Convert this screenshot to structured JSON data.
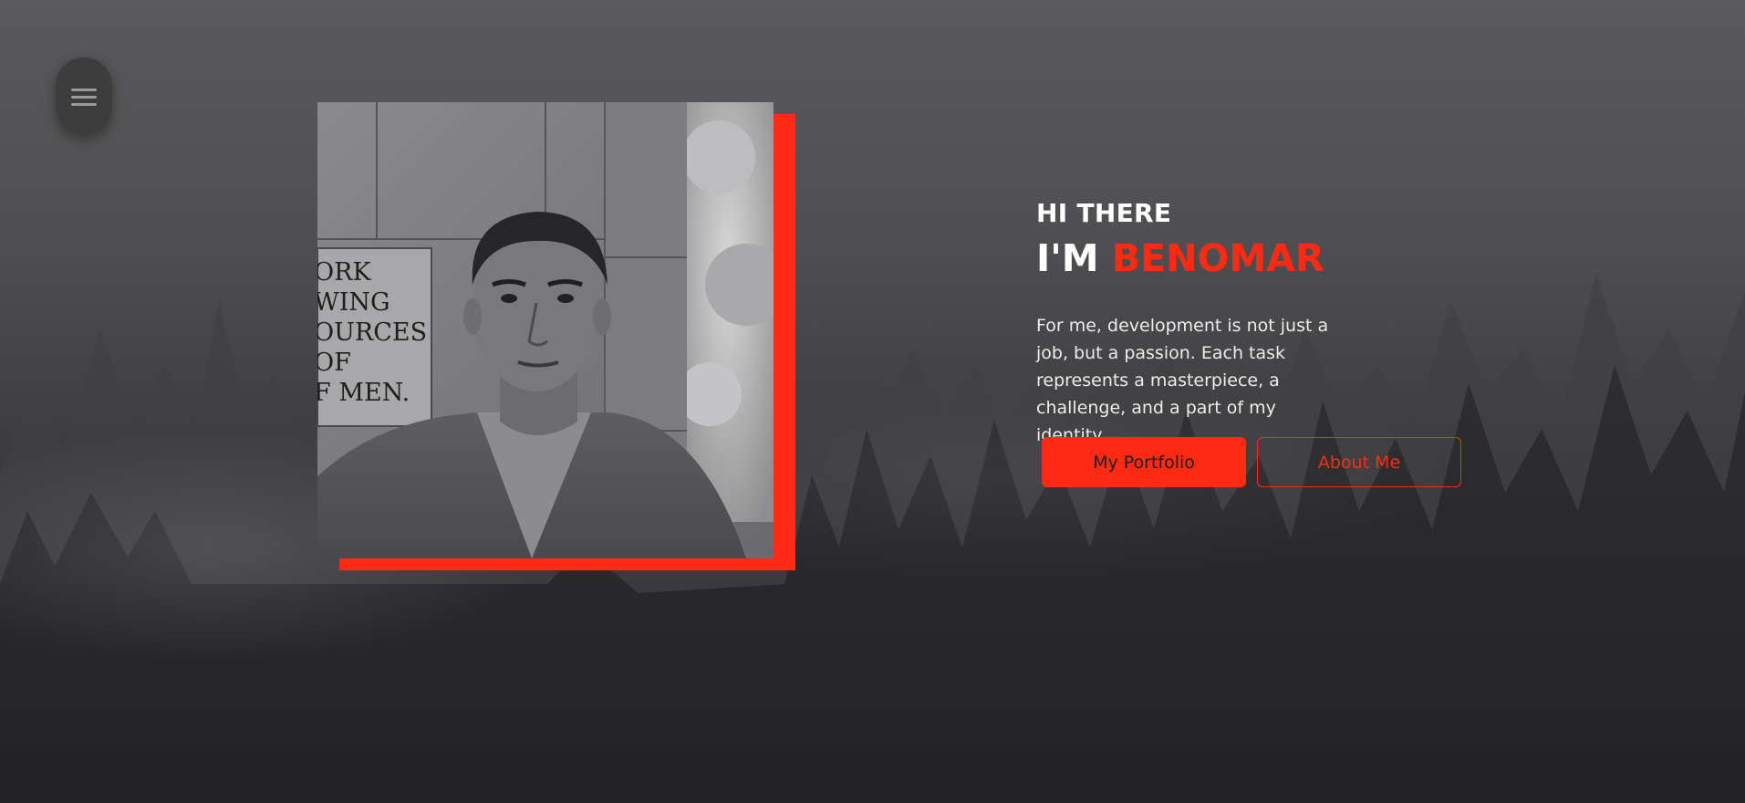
{
  "menu": {
    "icon": "hamburger-menu-icon"
  },
  "hero": {
    "greeting": "HI THERE",
    "name_prefix": "I'M ",
    "name": "BENOMAR",
    "description": "For me, development is not just a job, but a passion. Each task represents a masterpiece, a challenge, and a part of my identity.",
    "buttons": {
      "portfolio": "My Portfolio",
      "about": "About Me"
    }
  },
  "photo": {
    "plaque_lines": [
      "ORK",
      "WING",
      "OURCES",
      "OF",
      "F MEN."
    ]
  },
  "colors": {
    "accent": "#ff2a12",
    "background": "#4f4f51",
    "text": "#ffffff"
  }
}
